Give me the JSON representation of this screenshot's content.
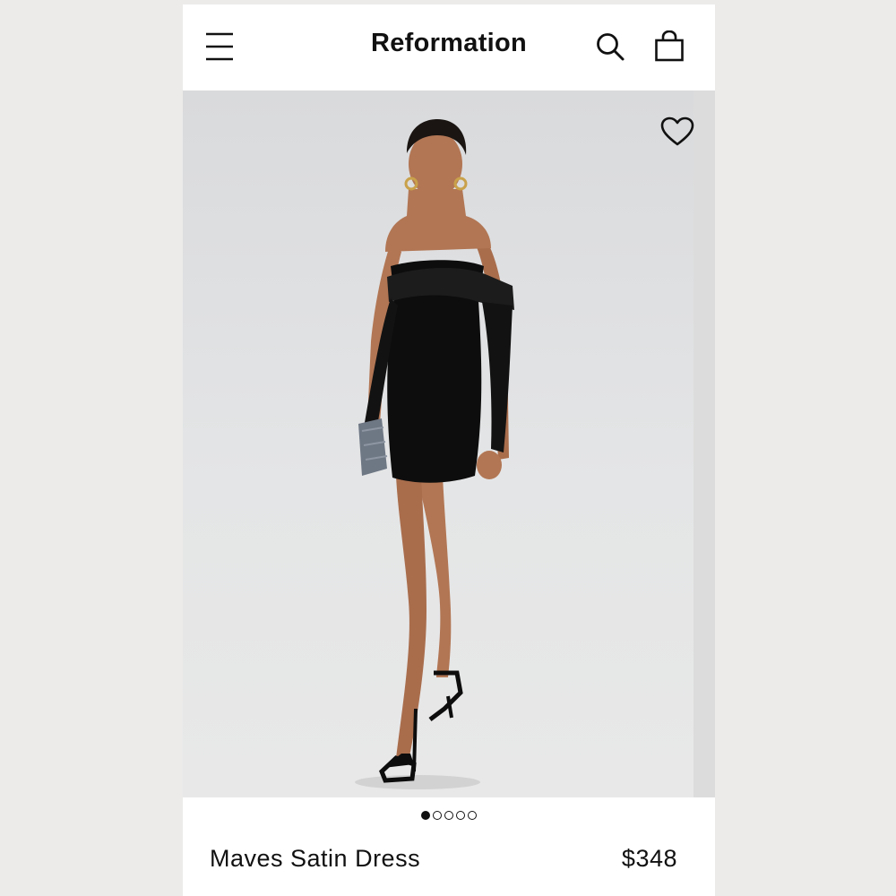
{
  "header": {
    "brand": "Reformation",
    "menu_icon": "hamburger-menu-icon",
    "search_icon": "search-icon",
    "bag_icon": "shopping-bag-icon"
  },
  "hero": {
    "favorite_icon": "heart-outline-icon",
    "image_alt": "Model wearing black off-the-shoulder satin mini dress",
    "carousel": {
      "count": 5,
      "active_index": 0
    }
  },
  "product": {
    "name": "Maves Satin Dress",
    "price": "$348"
  },
  "colors": {
    "text": "#111111",
    "background": "#ffffff",
    "photo_backdrop": "#e2e3e4",
    "dress": "#0d0d0d",
    "skin": "#b27654"
  }
}
